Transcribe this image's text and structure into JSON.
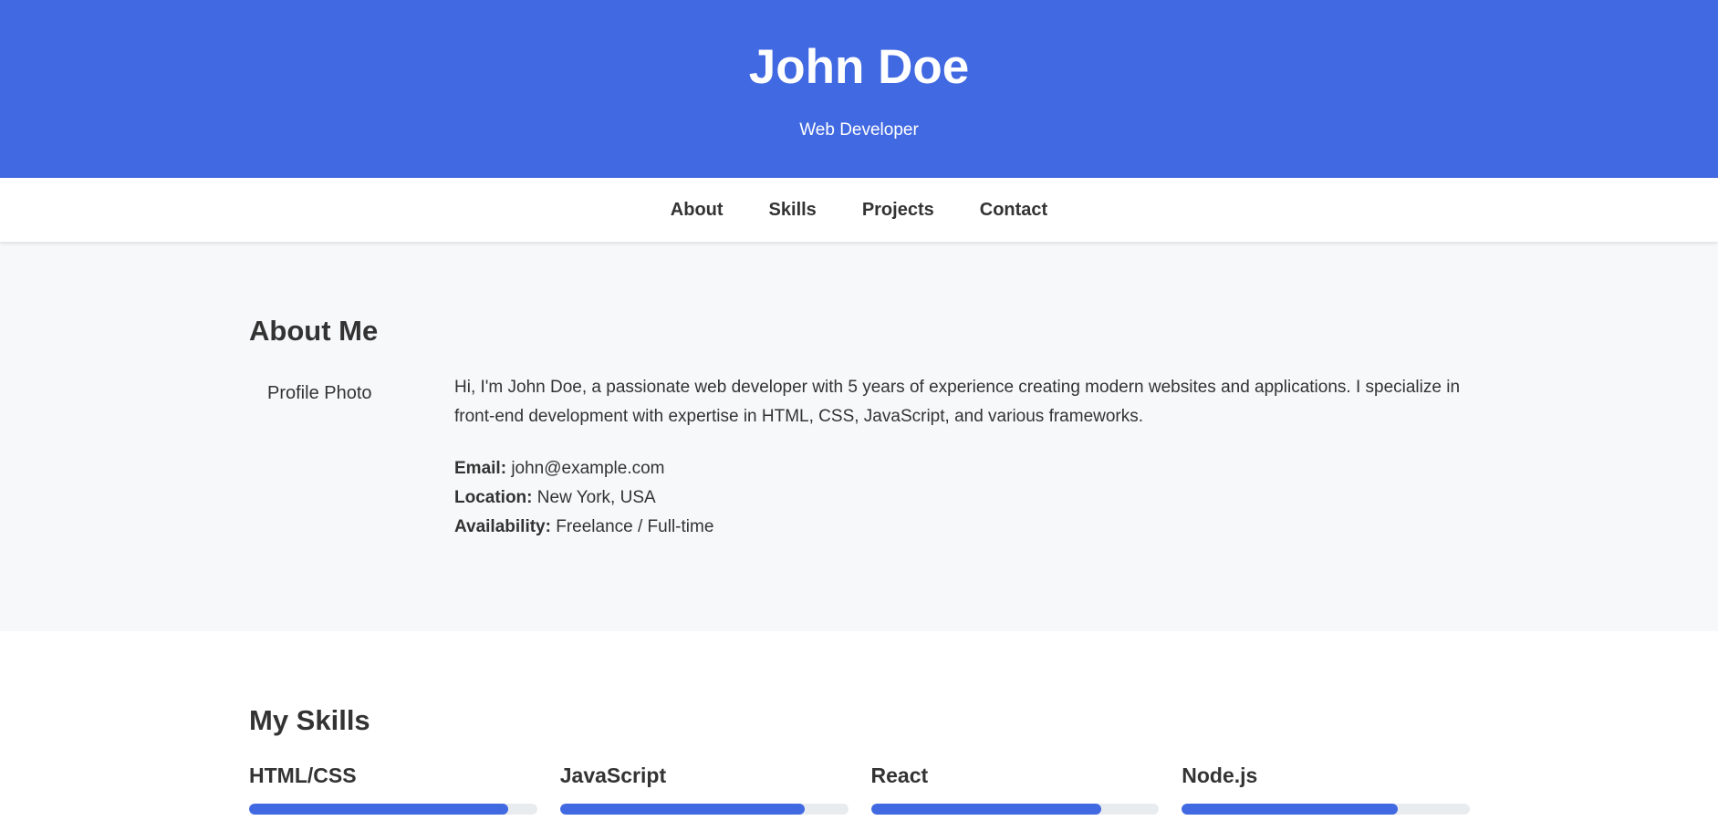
{
  "header": {
    "name": "John Doe",
    "subtitle": "Web Developer"
  },
  "nav": {
    "items": [
      "About",
      "Skills",
      "Projects",
      "Contact"
    ]
  },
  "about": {
    "title": "About Me",
    "photo_alt": "Profile Photo",
    "bio": "Hi, I'm John Doe, a passionate web developer with 5 years of experience creating modern websites and applications. I specialize in front-end development with expertise in HTML, CSS, JavaScript, and various frameworks.",
    "details": [
      {
        "label": "Email:",
        "value": "john@example.com"
      },
      {
        "label": "Location:",
        "value": "New York, USA"
      },
      {
        "label": "Availability:",
        "value": "Freelance / Full-time"
      }
    ]
  },
  "skills": {
    "title": "My Skills",
    "items": [
      {
        "name": "HTML/CSS",
        "level": 0.9
      },
      {
        "name": "JavaScript",
        "level": 0.85
      },
      {
        "name": "React",
        "level": 0.8
      },
      {
        "name": "Node.js",
        "level": 0.75
      }
    ]
  },
  "colors": {
    "primary": "#4169e1",
    "text": "#333333",
    "section_bg": "#f7f8fa",
    "track": "#e9ecef"
  }
}
